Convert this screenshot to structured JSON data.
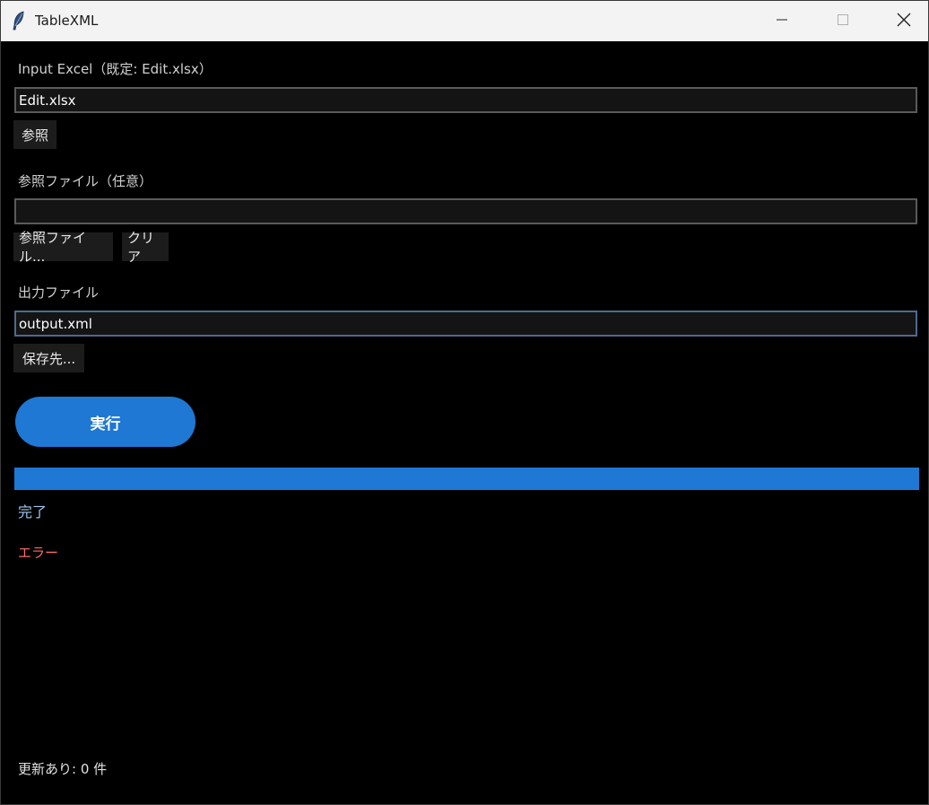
{
  "window": {
    "title": "TableXML",
    "icon": "feather-icon"
  },
  "input_excel": {
    "label": "Input Excel（既定: Edit.xlsx）",
    "value": "Edit.xlsx",
    "browse_label": "参照"
  },
  "reference_file": {
    "label": "参照ファイル（任意）",
    "value": "",
    "browse_label": "参照ファイル...",
    "clear_label": "クリア"
  },
  "output_file": {
    "label": "出力ファイル",
    "value": "output.xml",
    "save_label": "保存先..."
  },
  "run": {
    "label": "実行"
  },
  "progress": {
    "value": 1.0
  },
  "status": {
    "done": "完了",
    "error": "エラー"
  },
  "footer": {
    "summary": "更新あり: 0 件"
  },
  "colors": {
    "accent": "#1e78d4",
    "error": "#ff6b6b",
    "background": "#000000"
  }
}
